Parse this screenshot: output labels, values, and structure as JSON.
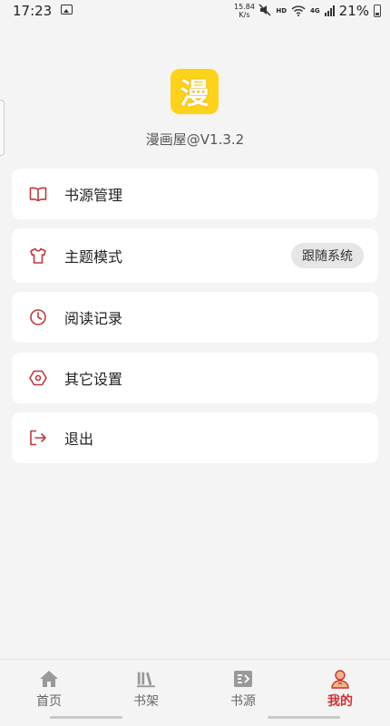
{
  "status_bar": {
    "time": "17:23",
    "net_speed_value": "15.84",
    "net_speed_unit": "K/s",
    "hd": "HD",
    "network": "4G",
    "battery": "21%"
  },
  "header": {
    "logo_char": "漫",
    "app_version": "漫画屋@V1.3.2",
    "logo_color": "#ffd21a"
  },
  "menu": {
    "book_source": "书源管理",
    "theme_mode": "主题模式",
    "theme_value": "跟随系统",
    "reading_history": "阅读记录",
    "other_settings": "其它设置",
    "logout": "退出"
  },
  "nav": {
    "home": "首页",
    "bookshelf": "书架",
    "sources": "书源",
    "mine": "我的",
    "active_color": "#d32f2f"
  },
  "icons": {
    "menu_icon_color": "#c0393b"
  }
}
